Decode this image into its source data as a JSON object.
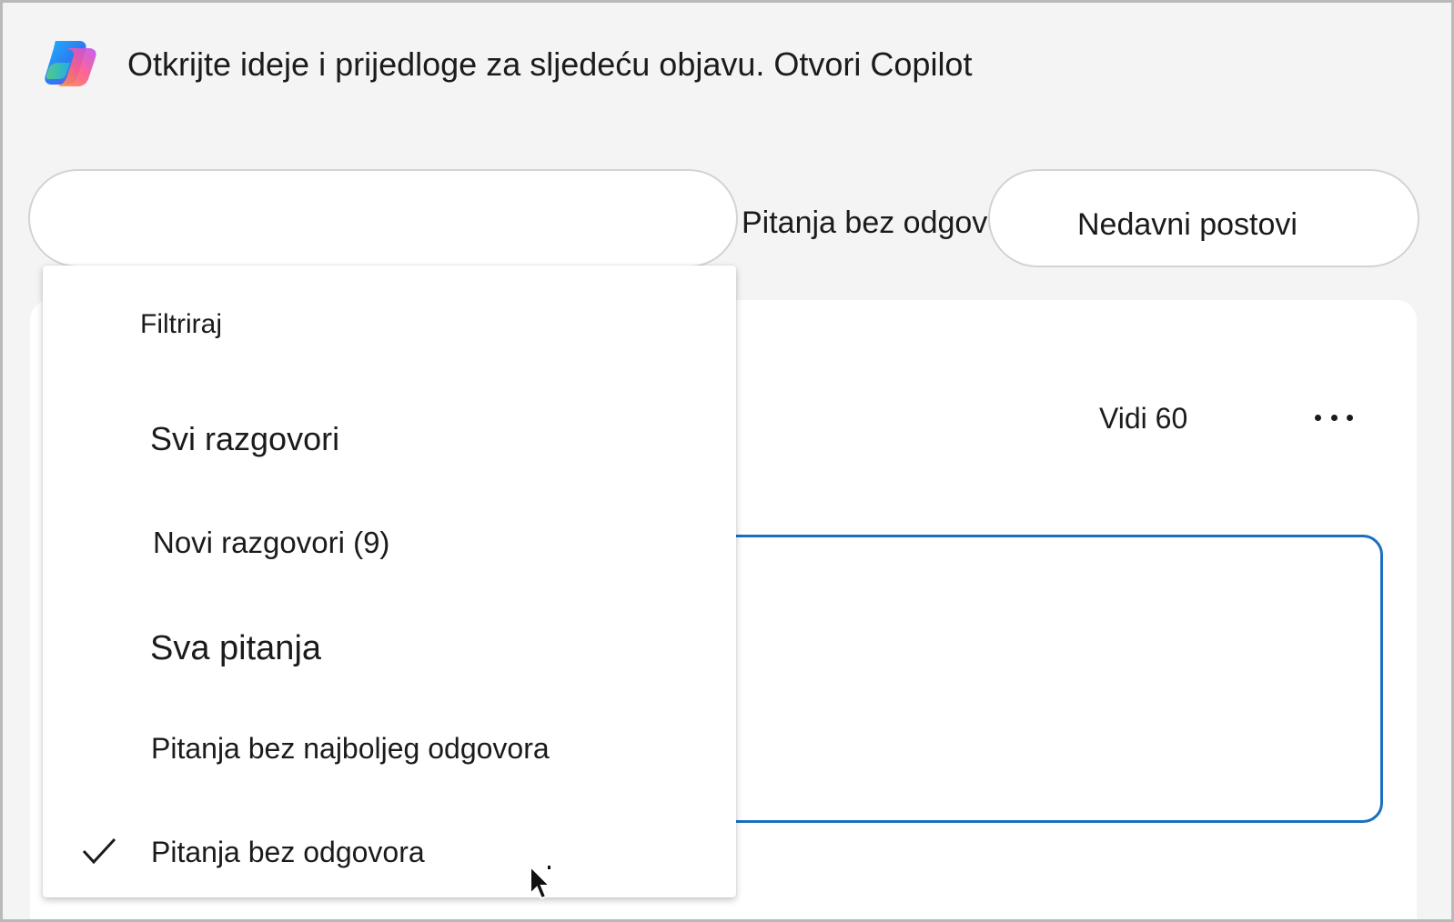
{
  "banner": {
    "text": "Otkrijte ideje i prijedloge za sljedeću objavu. Otvori Copilot",
    "logo_icon": "copilot-logo-icon"
  },
  "tabs": {
    "filter_value": "",
    "unanswered": "Pitanja bez odgovora",
    "recent": "Nedavni postovi"
  },
  "card": {
    "see_all": "Vidi 60",
    "more_icon": "more-horizontal-icon"
  },
  "filter_menu": {
    "header": "Filtriraj",
    "items": [
      {
        "label": "Svi razgovori",
        "selected": false
      },
      {
        "label": "Novi razgovori (9)",
        "selected": false
      },
      {
        "label": "Sva pitanja",
        "selected": false
      },
      {
        "label": "Pitanja bez najboljeg odgovora",
        "selected": false
      },
      {
        "label": "Pitanja bez odgovora",
        "selected": true
      }
    ],
    "check_icon": "checkmark-icon"
  },
  "colors": {
    "background": "#f4f4f4",
    "surface": "#ffffff",
    "text": "#1b1b1b",
    "focus_border": "#1b6fc0",
    "pill_border": "#d3d3d3"
  }
}
